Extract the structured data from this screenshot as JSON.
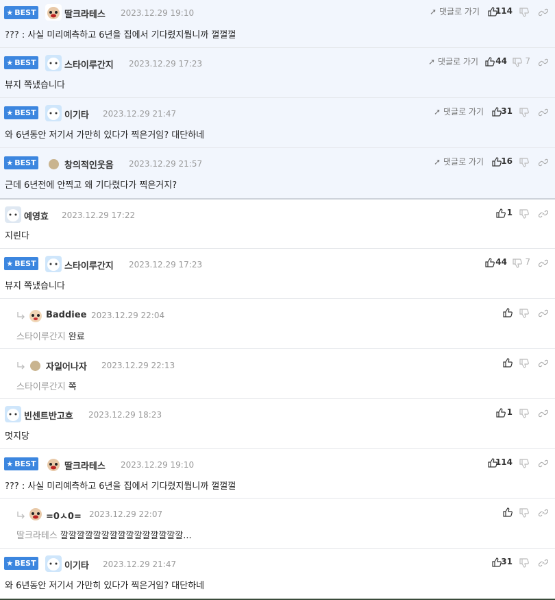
{
  "labels": {
    "best": "BEST",
    "goto": "댓글로 가기"
  },
  "best_comments": [
    {
      "nick": "딸크라테스",
      "date": "2023.12.29 19:10",
      "text": "??? : 사실 미리예측하고 6년을 집에서 기다렸지뭡니까 껄껄껄",
      "up": "114",
      "down": ""
    },
    {
      "nick": "스타이루간지",
      "date": "2023.12.29 17:23",
      "text": "뷰지 쪽냈습니다",
      "up": "44",
      "down": "7"
    },
    {
      "nick": "이기타",
      "date": "2023.12.29 21:47",
      "text": "와 6년동안 저기서 가만히 있다가 찍은거임? 대단하네",
      "up": "31",
      "down": ""
    },
    {
      "nick": "창의적인웃음",
      "date": "2023.12.29 21:57",
      "text": "근데 6년전에 안찍고 왜 기다렸다가 찍은거지?",
      "up": "16",
      "down": ""
    }
  ],
  "comments": [
    {
      "nick": "예영효",
      "date": "2023.12.29 17:22",
      "text": "지린다",
      "up": "1",
      "down": ""
    },
    {
      "nick": "스타이루간지",
      "date": "2023.12.29 17:23",
      "text": "뷰지 쪽냈습니다",
      "up": "44",
      "down": "7"
    },
    {
      "nick": "Baddiee",
      "date": "2023.12.29 22:04",
      "reply_to": "스타이루간지",
      "text": "완료",
      "up": "",
      "down": ""
    },
    {
      "nick": "자일어나자",
      "date": "2023.12.29 22:13",
      "reply_to": "스타이루간지",
      "text": "쪽",
      "up": "",
      "down": ""
    },
    {
      "nick": "빈센트반고흐",
      "date": "2023.12.29 18:23",
      "text": "멋지당",
      "up": "1",
      "down": ""
    },
    {
      "nick": "딸크라테스",
      "date": "2023.12.29 19:10",
      "text": "??? : 사실 미리예측하고 6년을 집에서 기다렸지뭡니까 껄껄껄",
      "up": "114",
      "down": ""
    },
    {
      "nick": "=0ㅅ0=",
      "date": "2023.12.29 22:07",
      "reply_to": "딸크라테스",
      "text": "깔깔깔깔깔깔깔깔깔깔깔깔깔깔깔...",
      "up": "",
      "down": ""
    },
    {
      "nick": "이기타",
      "date": "2023.12.29 21:47",
      "text": "와 6년동안 저기서 가만히 있다가 찍은거임? 대단하네",
      "up": "31",
      "down": ""
    }
  ],
  "colors": {
    "best_badge": "#3c86df",
    "best_bg": "#f2f6fd",
    "text": "#222222",
    "muted": "#999999"
  }
}
